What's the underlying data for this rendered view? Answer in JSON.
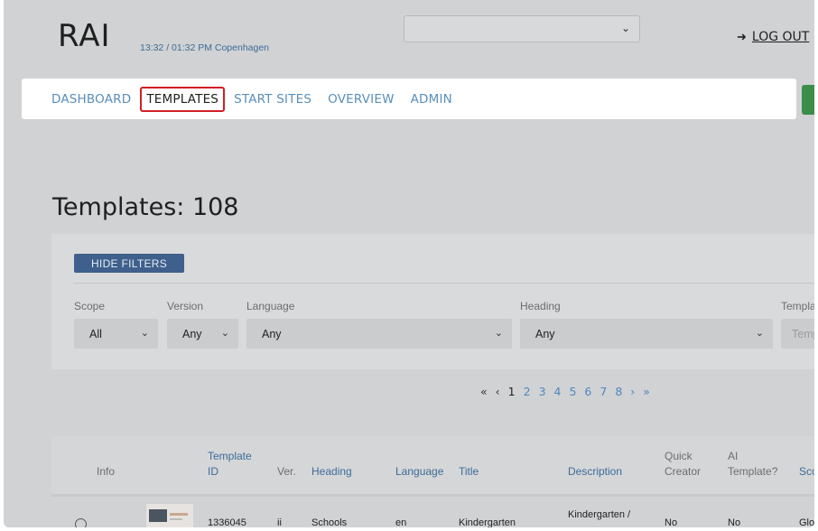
{
  "header": {
    "logo": "RAI",
    "clock": "13:32 / 01:32 PM Copenhagen",
    "site_select_value": "",
    "logout_label": "LOG OUT",
    "logout_icon": "sign-out-icon"
  },
  "nav": {
    "items": [
      {
        "label": "DASHBOARD"
      },
      {
        "label": "TEMPLATES",
        "active": true
      },
      {
        "label": "START SITES"
      },
      {
        "label": "OVERVIEW"
      },
      {
        "label": "ADMIN"
      }
    ]
  },
  "page": {
    "title": "Templates: 108"
  },
  "filters": {
    "toggle_label": "HIDE FILTERS",
    "fields": [
      {
        "label": "Scope",
        "value": "All"
      },
      {
        "label": "Version",
        "value": "Any"
      },
      {
        "label": "Language",
        "value": "Any"
      },
      {
        "label": "Heading",
        "value": "Any"
      },
      {
        "label": "Templa",
        "placeholder": "Temp"
      }
    ]
  },
  "pagination": {
    "first": "«",
    "prev": "‹",
    "pages": [
      "1",
      "2",
      "3",
      "4",
      "5",
      "6",
      "7",
      "8"
    ],
    "current": "1",
    "next": "›",
    "last": "»"
  },
  "table": {
    "columns": {
      "info": "Info",
      "template_id_1": "Template",
      "template_id_2": "ID",
      "ver": "Ver.",
      "heading": "Heading",
      "language": "Language",
      "title": "Title",
      "description": "Description",
      "quick_creator_1": "Quick",
      "quick_creator_2": "Creator",
      "ai_template_1": "AI",
      "ai_template_2": "Template?",
      "scope": "Sco"
    },
    "rows": [
      {
        "template_id": "1336045",
        "ver": "ii",
        "heading": "Schools",
        "language": "en",
        "title": "Kindergarten",
        "description": "Kindergarten /",
        "quick_creator": "No",
        "ai_template": "No",
        "scope": "Glo"
      }
    ]
  },
  "colors": {
    "accent": "#5a8fb9",
    "active_outline": "#d21e26",
    "button": "#3f5f8c",
    "green_tab": "#3c8d4a"
  }
}
